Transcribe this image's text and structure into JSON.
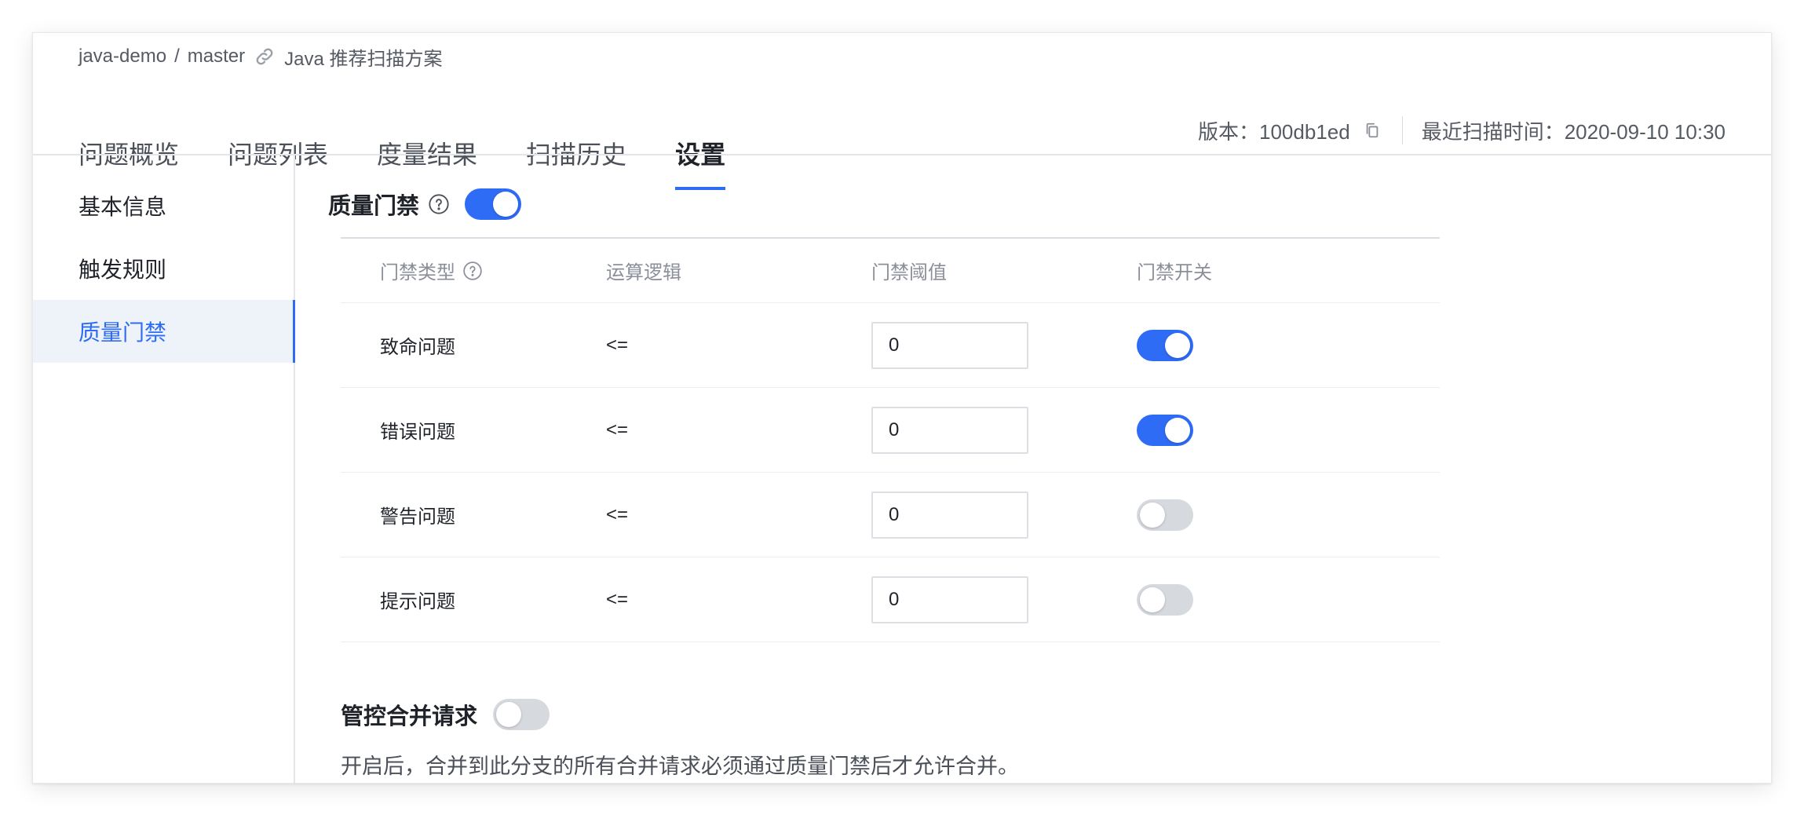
{
  "breadcrumb": {
    "repo": "java-demo",
    "separator": "/",
    "branch": "master",
    "scheme": "Java 推荐扫描方案"
  },
  "tabs": [
    {
      "label": "问题概览"
    },
    {
      "label": "问题列表"
    },
    {
      "label": "度量结果"
    },
    {
      "label": "扫描历史"
    },
    {
      "label": "设置",
      "active": true
    }
  ],
  "meta": {
    "version_label": "版本：100db1ed",
    "last_scan_label": "最近扫描时间：2020-09-10 10:30"
  },
  "sidebar": {
    "items": [
      {
        "label": "基本信息"
      },
      {
        "label": "触发规则"
      },
      {
        "label": "质量门禁",
        "active": true
      }
    ]
  },
  "quality_gate": {
    "title": "质量门禁",
    "enabled": true,
    "columns": [
      "门禁类型",
      "运算逻辑",
      "门禁阈值",
      "门禁开关"
    ],
    "rows": [
      {
        "type": "致命问题",
        "op": "<=",
        "threshold": "0",
        "enabled": true
      },
      {
        "type": "错误问题",
        "op": "<=",
        "threshold": "0",
        "enabled": true
      },
      {
        "type": "警告问题",
        "op": "<=",
        "threshold": "0",
        "enabled": false
      },
      {
        "type": "提示问题",
        "op": "<=",
        "threshold": "0",
        "enabled": false
      }
    ]
  },
  "merge_control": {
    "title": "管控合并请求",
    "enabled": false,
    "description": "开启后，合并到此分支的所有合并请求必须通过质量门禁后才允许合并。"
  },
  "colors": {
    "accent": "#2e6cf6",
    "toggle_off": "#d6d9de",
    "active_bg": "#eef2f9"
  }
}
